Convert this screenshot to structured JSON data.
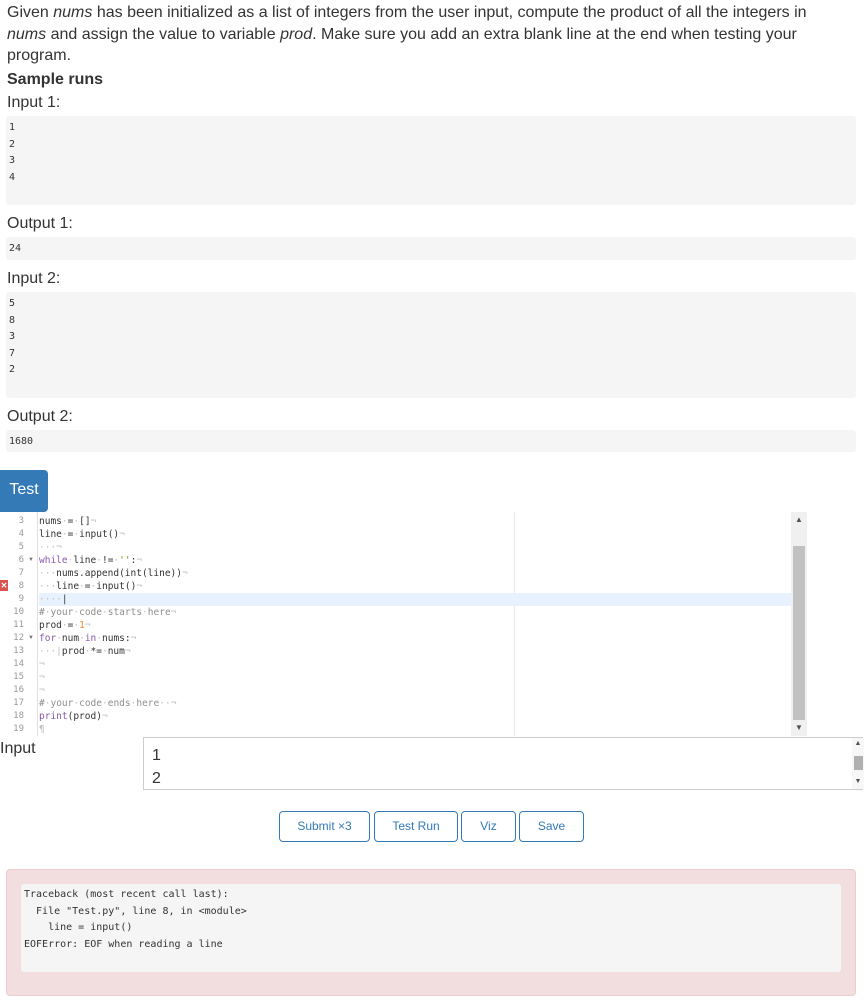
{
  "problem": {
    "text_1": "Given ",
    "em_1": "nums",
    "text_2": " has been initialized as a list of integers from the user input, compute the product of all the integers in ",
    "em_2": "nums",
    "text_3": " and assign the value to variable ",
    "em_3": "prod",
    "text_4": ". Make sure you add an extra blank line at the end when testing your program."
  },
  "sample_runs": {
    "heading": "Sample runs",
    "input_1_label": "Input 1:",
    "input_1_lines": [
      "1",
      "2",
      "3",
      "4"
    ],
    "output_1_label": "Output 1:",
    "output_1": "24",
    "input_2_label": "Input 2:",
    "input_2_lines": [
      "5",
      "8",
      "3",
      "7",
      "2"
    ],
    "output_2_label": "Output 2:",
    "output_2": "1680"
  },
  "tab": {
    "label": "Test"
  },
  "editor": {
    "line_numbers": [
      "3",
      "4",
      "5",
      "6",
      "7",
      "8",
      "9",
      "10",
      "11",
      "12",
      "13",
      "14",
      "15",
      "16",
      "17",
      "18",
      "19"
    ],
    "folded_lines": [
      "6",
      "12"
    ],
    "error_line": "8",
    "active_line": "9"
  },
  "input_panel": {
    "label": "Input",
    "lines": [
      "1",
      "2"
    ]
  },
  "buttons": {
    "submit": "Submit ×3",
    "test_run": "Test Run",
    "viz": "Viz",
    "save": "Save"
  },
  "traceback": {
    "line_1": "Traceback (most recent call last):",
    "line_2": "  File \"Test.py\", line 8, in <module>",
    "line_3": "    line = input()",
    "line_4": "EOFError: EOF when reading a line"
  },
  "colors": {
    "primary": "#337ab7",
    "error_bg": "#f2dede",
    "code_bg": "#f5f5f5",
    "keyword": "#8959a8"
  }
}
